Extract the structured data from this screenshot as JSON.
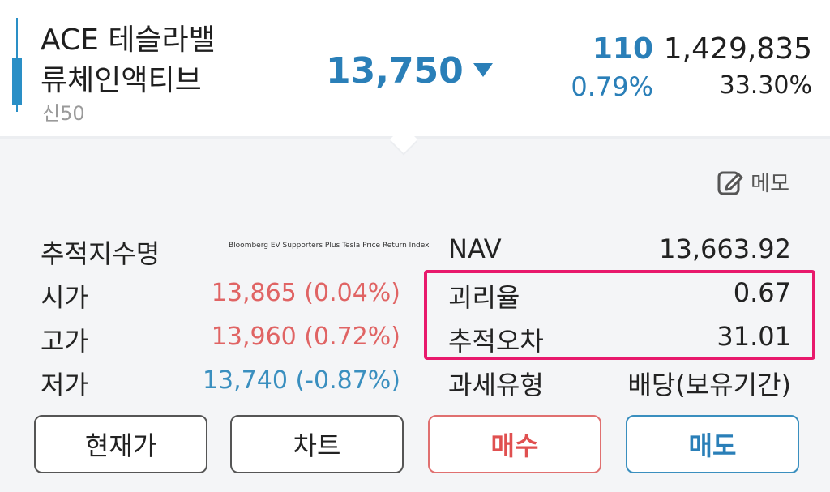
{
  "header": {
    "name_line1": "ACE 테슬라밸",
    "name_line2": "류체인액티브",
    "sub_label": "신50",
    "price": "13,750",
    "change_value": "110",
    "change_percent": "0.79%",
    "volume": "1,429,835",
    "volume_percent": "33.30%"
  },
  "memo": {
    "label": "메모",
    "icon": "edit-note-icon"
  },
  "left_rows": [
    {
      "label": "추적지수명",
      "value": "Bloomberg EV Supporters Plus Tesla Price Return Index"
    },
    {
      "label": "시가",
      "value": "13,865 (0.04%)"
    },
    {
      "label": "고가",
      "value": "13,960 (0.72%)"
    },
    {
      "label": "저가",
      "value": "13,740 (-0.87%)"
    }
  ],
  "right_rows": [
    {
      "label": "NAV",
      "value": "13,663.92"
    },
    {
      "label": "괴리율",
      "value": "0.67"
    },
    {
      "label": "추적오차",
      "value": "31.01"
    },
    {
      "label": "과세유형",
      "value": "배당(보유기간)"
    }
  ],
  "buttons": {
    "current_price": "현재가",
    "chart": "차트",
    "buy": "매수",
    "sell": "매도"
  },
  "colors": {
    "down_blue": "#2a7fb8",
    "up_red": "#e06464",
    "highlight": "#e8196c"
  }
}
